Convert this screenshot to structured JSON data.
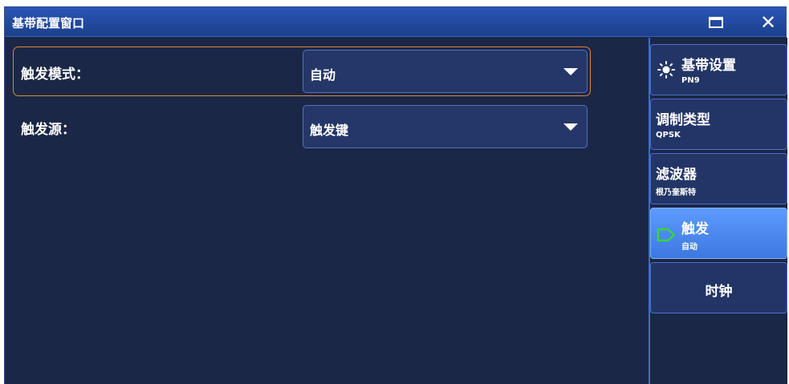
{
  "window": {
    "title": "基带配置窗口",
    "close_glyph": "✕"
  },
  "main": {
    "rows": [
      {
        "label": "触发模式：",
        "value": "自动"
      },
      {
        "label": "触发源：",
        "value": "触发键"
      }
    ]
  },
  "sidebar": {
    "items": [
      {
        "title": "基带设置",
        "subtitle": "PN9",
        "icon": "sun-icon"
      },
      {
        "title": "调制类型",
        "subtitle": "QPSK"
      },
      {
        "title": "滤波器",
        "subtitle": "根乃奎斯特"
      },
      {
        "title": "触发",
        "subtitle": "自动",
        "icon": "trigger-icon",
        "active": true
      },
      {
        "title": "时钟"
      }
    ]
  },
  "colors": {
    "background": "#1b2746",
    "titlebar": "#2a56b6",
    "focus_border": "#d98a3a",
    "active_tab": "#5d9bff",
    "trigger_icon": "#32d93b"
  }
}
